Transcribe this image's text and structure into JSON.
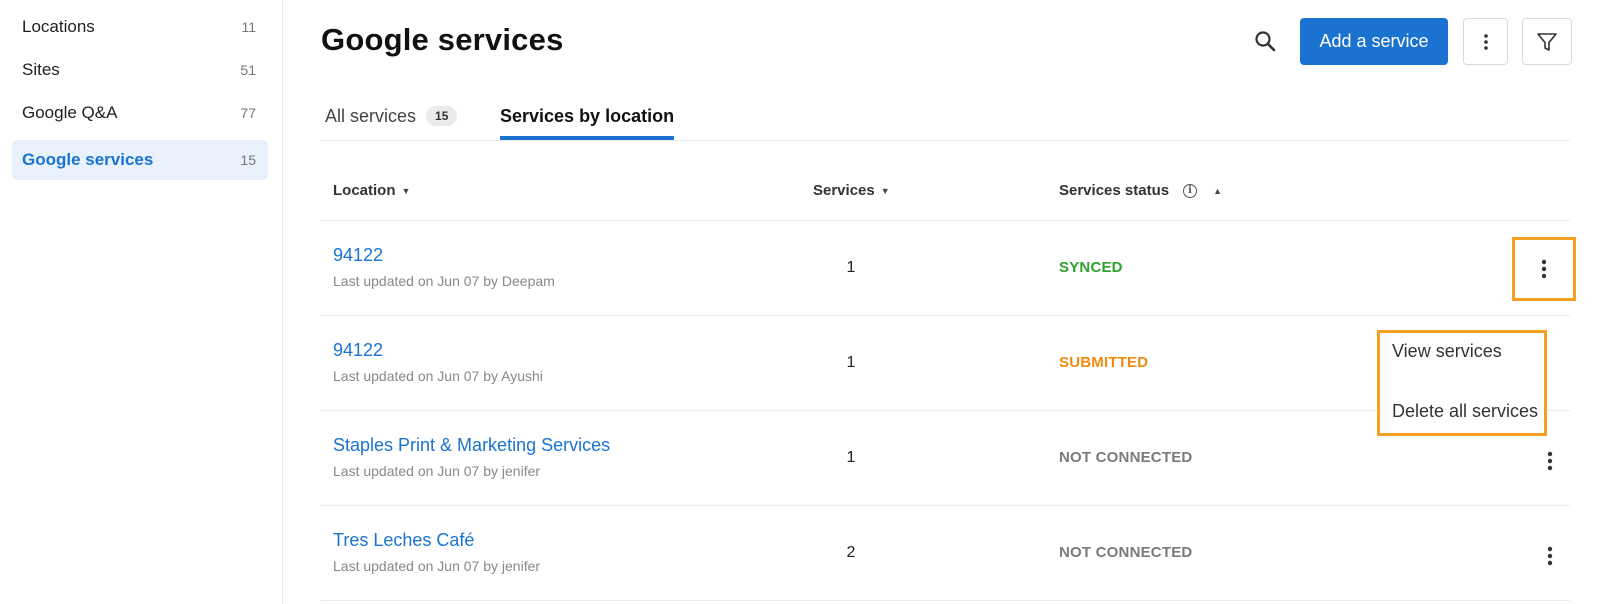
{
  "sidebar": {
    "items": [
      {
        "label": "Locations",
        "count": "11"
      },
      {
        "label": "Sites",
        "count": "51"
      },
      {
        "label": "Google Q&A",
        "count": "77"
      },
      {
        "label": "Google services",
        "count": "15"
      }
    ]
  },
  "header": {
    "title": "Google services",
    "add_label": "Add a service",
    "icons": [
      "search-icon",
      "more-vertical-icon",
      "filter-icon"
    ]
  },
  "tabs": [
    {
      "label": "All services",
      "badge": "15"
    },
    {
      "label": "Services by location"
    }
  ],
  "table": {
    "columns": {
      "location": "Location",
      "services": "Services",
      "status": "Services status"
    },
    "rows": [
      {
        "name": "94122",
        "updated": "Last updated on Jun 07 by Deepam",
        "services": "1",
        "status": "SYNCED"
      },
      {
        "name": "94122",
        "updated": "Last updated on Jun 07 by Ayushi",
        "services": "1",
        "status": "SUBMITTED"
      },
      {
        "name": "Staples Print & Marketing Services",
        "updated": "Last updated on Jun 07 by jenifer",
        "services": "1",
        "status": "NOT CONNECTED"
      },
      {
        "name": "Tres Leches Café",
        "updated": "Last updated on Jun 07 by jenifer",
        "services": "2",
        "status": "NOT CONNECTED"
      }
    ]
  },
  "row_menu": {
    "items": [
      "View services",
      "Delete all services"
    ]
  },
  "colors": {
    "accent": "#1a73d0",
    "highlight": "#f5a022",
    "synced": "#2ea12e",
    "submitted": "#f08a10",
    "not_connected": "#7a7a7a"
  }
}
